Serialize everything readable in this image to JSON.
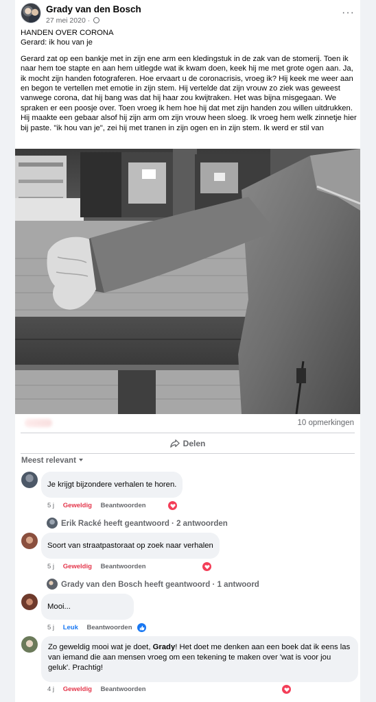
{
  "post": {
    "author": "Grady van den Bosch",
    "date": "27 mei 2020 ·",
    "more_label": "···",
    "title_line1": "HANDEN OVER CORONA",
    "title_line2": "Gerard: ik hou van je",
    "body": "Gerard zat op een bankje met in zijn ene arm een kledingstuk in de zak van de stomerij. Toen ik naar hem toe stapte en aan hem uitlegde wat ik kwam doen, keek hij me met grote ogen aan. Ja, ik mocht zijn handen fotograferen. Hoe ervaart u de coronacrisis, vroeg ik? Hij keek me weer aan en begon te vertellen met emotie in zijn stem. Hij vertelde dat zijn vrouw zo ziek was geweest vanwege corona, dat hij bang was dat hij haar zou kwijtraken. Het was bijna misgegaan. We spraken er een poosje over. Toen vroeg ik hem hoe hij dat met zijn handen zou willen uitdrukken. Hij maakte een gebaar alsof hij zijn arm om zijn vrouw heen sloeg. Ik vroeg hem welk zinnetje hier bij paste. \"ik hou van je\", zei hij met tranen in zijn ogen en in zijn stem. Ik werd er stil van",
    "comment_count": "10 opmerkingen",
    "share_label": "Delen"
  },
  "comments_section": {
    "sort_label": "Meest relevant"
  },
  "comments": [
    {
      "text": "Je krijgt bijzondere verhalen te horen.",
      "age": "5 j",
      "reaction_label": "Geweldig",
      "reply_label": "Beantwoorden",
      "reaction_icon": "heart-icon",
      "replies_line": "Erik Racké heeft geantwoord · 2 antwoorden"
    },
    {
      "text": "Soort van straatpastoraat op zoek naar verhalen",
      "age": "5 j",
      "reaction_label": "Geweldig",
      "reply_label": "Beantwoorden",
      "reaction_icon": "heart-icon",
      "replies_line": "Grady van den Bosch heeft geantwoord · 1 antwoord"
    },
    {
      "text": "Mooi...",
      "age": "5 j",
      "reaction_label": "Leuk",
      "reply_label": "Beantwoorden",
      "reaction_icon": "thumbs-up-icon"
    },
    {
      "text_before": "Zo geweldig mooi wat je doet, ",
      "text_bold": "Grady",
      "text_after": "! Het doet me denken aan een boek dat ik eens las van iemand die aan mensen vroeg om een tekening te maken over 'wat is voor jou geluk'. Prachtig!",
      "age": "4 j",
      "reaction_label": "Geweldig",
      "reply_label": "Beantwoorden",
      "reaction_icon": "heart-icon"
    }
  ],
  "colors": {
    "love": "#f33e58",
    "like": "#1877f2",
    "geweldig_text": "#e4374c",
    "secondary_text": "#65676b"
  }
}
